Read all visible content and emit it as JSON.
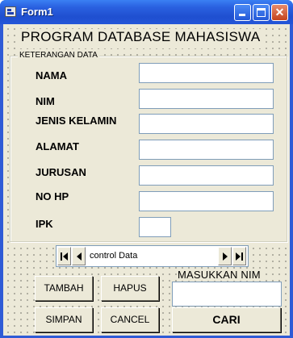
{
  "window": {
    "title": "Form1"
  },
  "form": {
    "heading": "PROGRAM DATABASE MAHASISWA",
    "frame_caption": "KETERANGAN DATA",
    "fields": [
      {
        "label": "NAMA",
        "value": ""
      },
      {
        "label": "NIM",
        "value": ""
      },
      {
        "label": "JENIS KELAMIN",
        "value": ""
      },
      {
        "label": "ALAMAT",
        "value": ""
      },
      {
        "label": "JURUSAN",
        "value": ""
      },
      {
        "label": "NO HP",
        "value": ""
      },
      {
        "label": "IPK",
        "value": ""
      }
    ]
  },
  "data_control": {
    "caption": "control Data"
  },
  "buttons": {
    "tambah": "TAMBAH",
    "hapus": "HAPUS",
    "simpan": "SIMPAN",
    "cancel": "CANCEL",
    "cari": "CARI"
  },
  "search": {
    "label": "MASUKKAN NIM",
    "value": ""
  },
  "colors": {
    "titlebar": "#2a60e0",
    "face": "#ece9d8",
    "close_button": "#c4431e"
  },
  "icons": [
    "app-icon",
    "minimize-icon",
    "maximize-icon",
    "close-icon",
    "first-record-icon",
    "previous-record-icon",
    "next-record-icon",
    "last-record-icon"
  ]
}
